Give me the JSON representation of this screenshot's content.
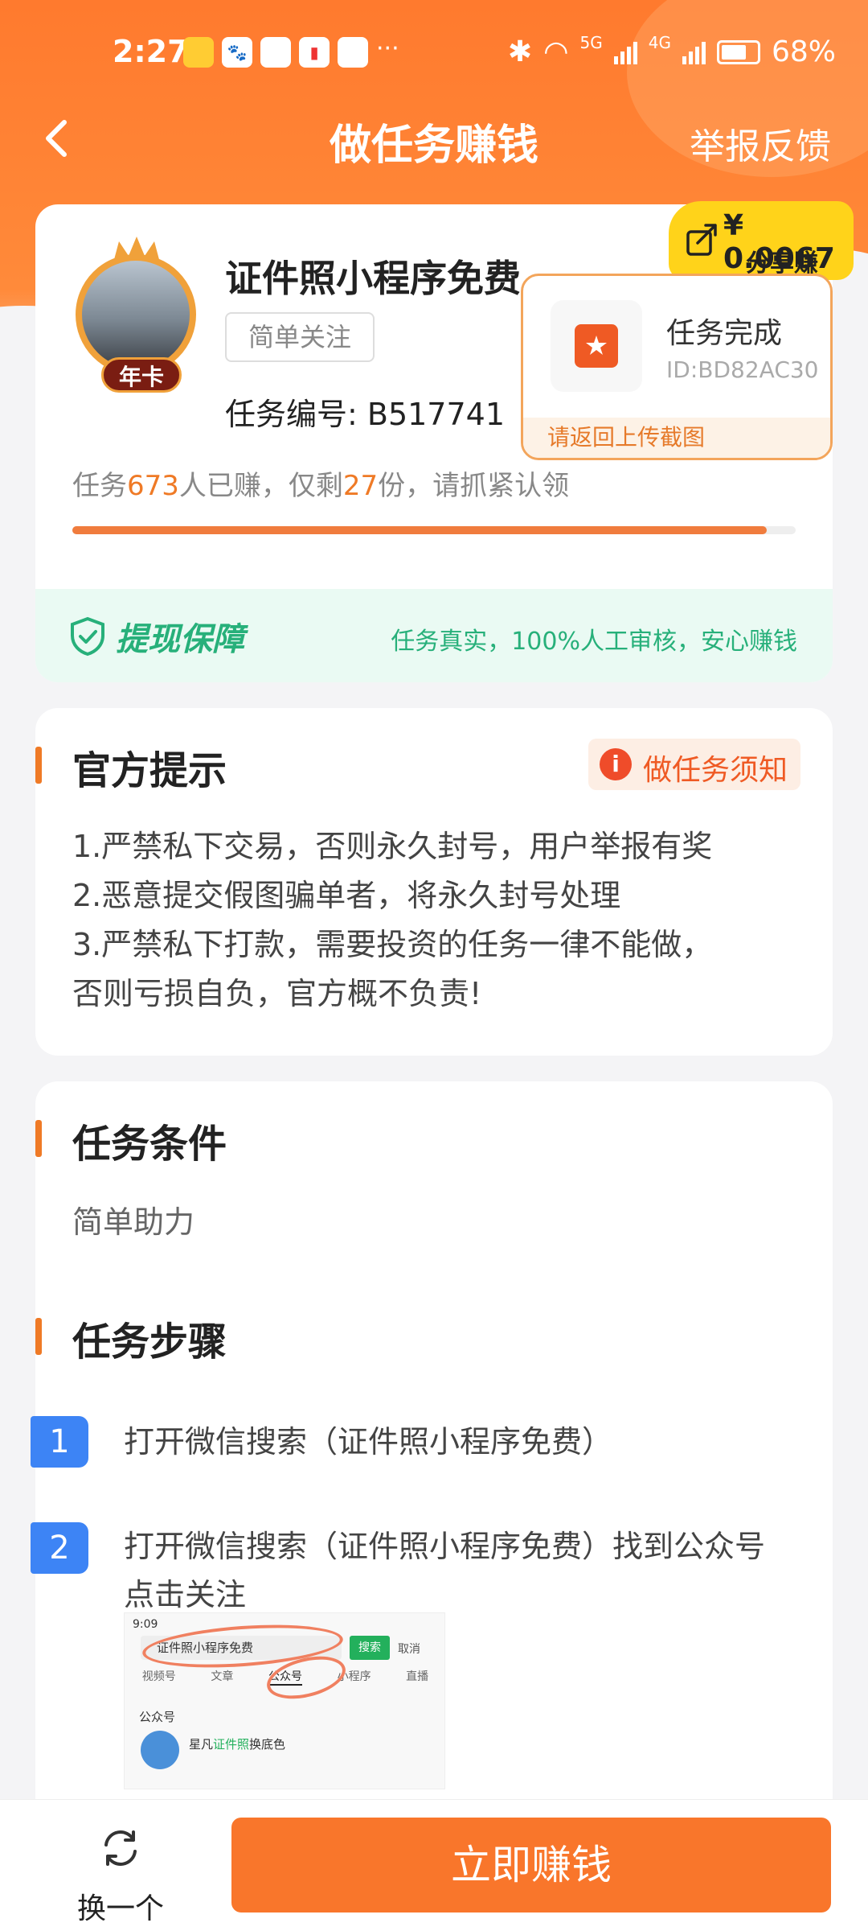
{
  "status_bar": {
    "time": "2:27",
    "network_1": "5G",
    "network_2": "4G",
    "battery": "68%"
  },
  "nav": {
    "back_icon": "chevron-left-icon",
    "title": "做任务赚钱",
    "report": "举报反馈"
  },
  "task": {
    "name": "证件照小程序免费",
    "tag": "简单关注",
    "number_label": "任务编号: B517741",
    "avatar_badge": "年卡",
    "progress_prefix": "任务",
    "earned_count": "673",
    "progress_mid": "人已赚，仅剩",
    "remaining": "27",
    "progress_suffix": "份，请抓紧认领",
    "progress_fraction": 0.96
  },
  "share": {
    "amount": "¥ 0.0067",
    "label": "分享赚"
  },
  "popup": {
    "title": "任务完成",
    "id": "ID:BD82AC30",
    "footer": "请返回上传截图"
  },
  "guarantee": {
    "title": "提现保障",
    "desc": "任务真实，100%人工审核，安心赚钱"
  },
  "tips": {
    "title": "官方提示",
    "notice_button": "做任务须知",
    "lines": [
      "1.严禁私下交易，否则永久封号，用户举报有奖",
      "2.恶意提交假图骗单者，将永久封号处理",
      "3.严禁私下打款，需要投资的任务一律不能做，",
      "否则亏损自负，官方概不负责!"
    ]
  },
  "conditions": {
    "title": "任务条件",
    "text": "简单助力"
  },
  "steps": {
    "title": "任务步骤",
    "items": [
      {
        "num": "1",
        "lines": [
          "打开微信搜索（证件照小程序免费）"
        ]
      },
      {
        "num": "2",
        "lines": [
          "打开微信搜索（证件照小程序免费）找到公众号",
          "点击关注"
        ]
      }
    ]
  },
  "screenshot": {
    "time": "9:09",
    "search": "证件照小程序免费",
    "search_btn": "搜索",
    "cancel": "取消",
    "tabs": [
      "视频号",
      "文章",
      "公众号",
      "小程序",
      "直播"
    ],
    "section": "公众号",
    "item_prefix": "星凡",
    "item_hl": "证件照",
    "item_suffix": "换底色"
  },
  "bottom": {
    "swap": "换一个",
    "earn": "立即赚钱"
  },
  "colors": {
    "accent": "#f9762b",
    "green": "#27b07a",
    "blue": "#3d84f5"
  }
}
